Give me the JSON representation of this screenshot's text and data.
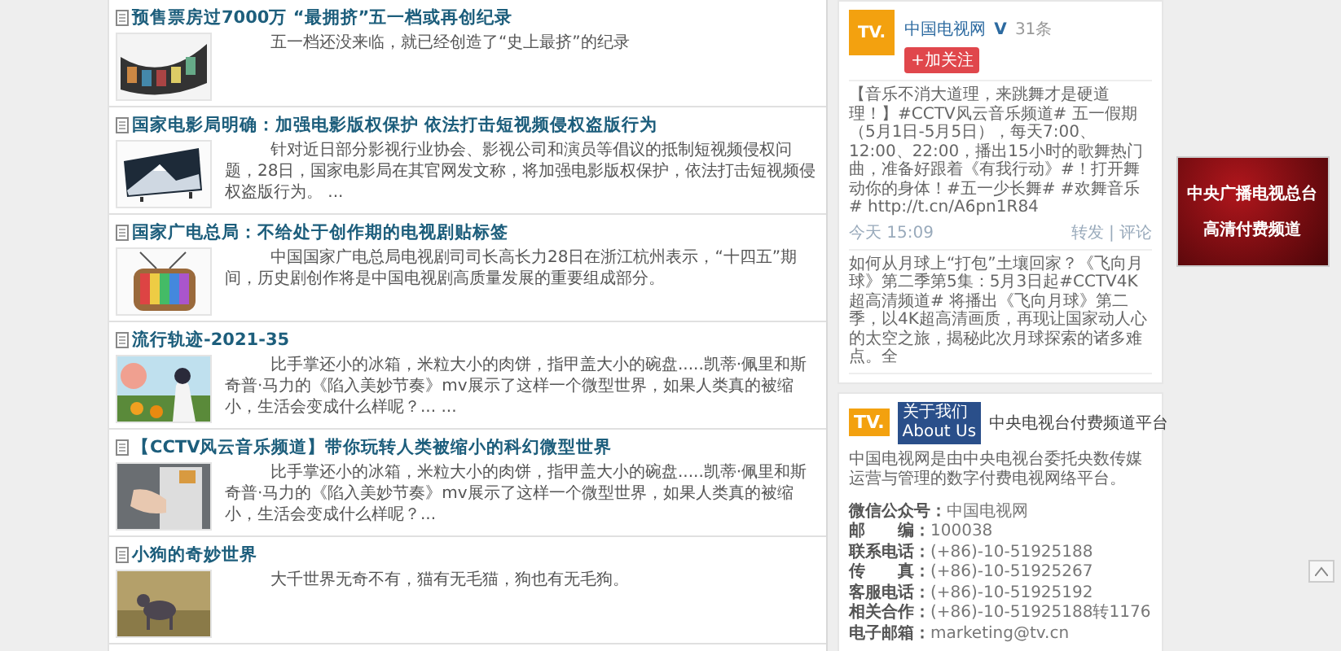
{
  "articles": [
    {
      "title": "预售票房过7000万 “最拥挤”五一档或再创纪录",
      "summary": "五一档还没来临，就已经创造了“史上最挤”的纪录"
    },
    {
      "title": "国家电影局明确：加强电影版权保护 依法打击短视频侵权盗版行为",
      "summary": "针对近日部分影视行业协会、影视公司和演员等倡议的抵制短视频侵权问题，28日，国家电影局在其官网发文称，将加强电影版权保护，依法打击短视频侵权盗版行为。 ..."
    },
    {
      "title": "国家广电总局：不给处于创作期的电视剧贴标签",
      "summary": "中国国家广电总局电视剧司司长高长力28日在浙江杭州表示，“十四五”期间，历史剧创作将是中国电视剧高质量发展的重要组成部分。"
    },
    {
      "title": "流行轨迹-2021-35",
      "summary": "比手掌还小的冰箱，米粒大小的肉饼，指甲盖大小的碗盘.....凯蒂·佩里和斯奇普·马力的《陷入美妙节奏》mv展示了这样一个微型世界，如果人类真的被缩小，生活会变成什么样呢？... ..."
    },
    {
      "title": "【CCTV风云音乐频道】带你玩转人类被缩小的科幻微型世界",
      "summary": "比手掌还小的冰箱，米粒大小的肉饼，指甲盖大小的碗盘.....凯蒂·佩里和斯奇普·马力的《陷入美妙节奏》mv展示了这样一个微型世界，如果人类真的被缩小，生活会变成什么样呢？..."
    },
    {
      "title": "小狗的奇妙世界",
      "summary": "大千世界无奇不有，猫有无毛猫，狗也有无毛狗。"
    }
  ],
  "weibo": {
    "avatar_text": "TV.",
    "account": "中国电视网",
    "verified_mark": "V",
    "count": "31条",
    "follow_button": "+加关注",
    "posts": [
      {
        "text": "【音乐不消大道理，来跳舞才是硬道理！】#CCTV风云音乐频道# 五一假期（5月1日-5月5日），每天7:00、12:00、22:00，播出15小时的歌舞热门曲，准备好跟着《有我行动》#！打开舞动你的身体！#五一少长舞# #欢舞音乐# http://t.cn/A6pn1R84",
        "time": "今天 15:09",
        "actions": "转发 | 评论"
      },
      {
        "text": "如何从月球上“打包”土壤回家？《飞向月球》第二季第5集：5月3日起#CCTV4K超高清频道# 将播出《飞向月球》第二季，以4K超高清画质，再现让国家动人心的太空之旅，揭秘此次月球探索的诸多难点。全"
      }
    ]
  },
  "about": {
    "logo_mark": "TV.",
    "logo_label": "关于我们",
    "logo_sub": "About Us",
    "tagline": "中央电视台付费频道平台",
    "description": "中国电视网是由中央电视台委托央数传媒运营与管理的数字付费电视网络平台。",
    "contacts": [
      {
        "label": "微信公众号：",
        "value": "中国电视网"
      },
      {
        "label": "邮　　编：",
        "value": "100038"
      },
      {
        "label": "联系电话：",
        "value": "(+86)-10-51925188"
      },
      {
        "label": "传　　真：",
        "value": "(+86)-10-51925267"
      },
      {
        "label": "客服电话：",
        "value": "(+86)-10-51925192"
      },
      {
        "label": "相关合作：",
        "value": "(+86)-10-51925188转1176"
      },
      {
        "label": "电子邮箱：",
        "value": "marketing@tv.cn"
      }
    ]
  },
  "ad": {
    "lines": [
      "中央广播电视总台",
      "高清付费频道"
    ]
  }
}
